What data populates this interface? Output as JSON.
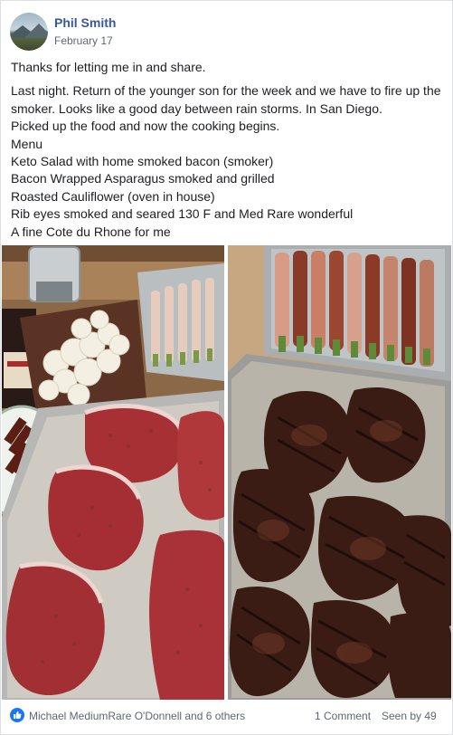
{
  "post": {
    "author": "Phil Smith",
    "date": "February 17",
    "lines": [
      "Thanks for letting me in and share.",
      "Last night. Return of the younger son for the week and we have to fire up the smoker. Looks like a good day between rain storms. In San Diego.",
      "Picked up the food and now the cooking begins.",
      "Menu",
      "Keto Salad with home smoked bacon (smoker)",
      "Bacon Wrapped Asparagus smoked and grilled",
      "Roasted Cauliflower (oven in house)",
      "Rib eyes smoked and seared 130 F and Med Rare wonderful",
      "A fine Cote du Rhone for me"
    ]
  },
  "photos": [
    {
      "icon": "raw-ribeyes-photo"
    },
    {
      "icon": "grilled-ribeyes-photo"
    }
  ],
  "footer": {
    "reactors": "Michael MediumRare O'Donnell and 6 others",
    "comments": "1 Comment",
    "seen": "Seen by 49"
  },
  "colors": {
    "link": "#385898",
    "like_blue": "#1877f2",
    "meta_gray": "#616770"
  }
}
